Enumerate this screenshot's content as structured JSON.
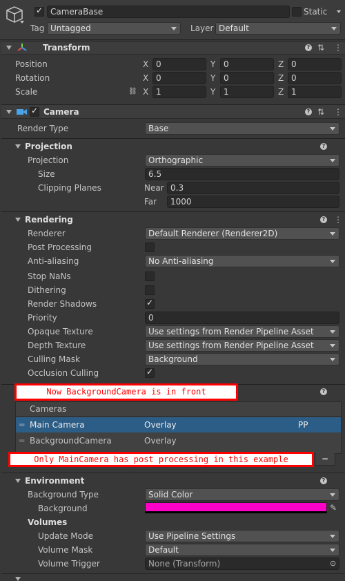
{
  "header": {
    "object_name": "CameraBase",
    "static_label": "Static",
    "tag_label": "Tag",
    "tag_value": "Untagged",
    "layer_label": "Layer",
    "layer_value": "Default"
  },
  "transform": {
    "title": "Transform",
    "position": {
      "label": "Position",
      "x": "0",
      "y": "0",
      "z": "0"
    },
    "rotation": {
      "label": "Rotation",
      "x": "0",
      "y": "0",
      "z": "0"
    },
    "scale": {
      "label": "Scale",
      "x": "1",
      "y": "1",
      "z": "1"
    },
    "axis_x": "X",
    "axis_y": "Y",
    "axis_z": "Z"
  },
  "camera": {
    "title": "Camera",
    "render_type_label": "Render Type",
    "render_type_value": "Base",
    "projection": {
      "title": "Projection",
      "projection_label": "Projection",
      "projection_value": "Orthographic",
      "size_label": "Size",
      "size_value": "6.5",
      "clipping_label": "Clipping Planes",
      "near_label": "Near",
      "near_value": "0.3",
      "far_label": "Far",
      "far_value": "1000"
    },
    "rendering": {
      "title": "Rendering",
      "renderer_label": "Renderer",
      "renderer_value": "Default Renderer (Renderer2D)",
      "post_processing_label": "Post Processing",
      "anti_aliasing_label": "Anti-aliasing",
      "anti_aliasing_value": "No Anti-aliasing",
      "stop_nans_label": "Stop NaNs",
      "dithering_label": "Dithering",
      "render_shadows_label": "Render Shadows",
      "priority_label": "Priority",
      "priority_value": "0",
      "opaque_texture_label": "Opaque Texture",
      "opaque_texture_value": "Use settings from Render Pipeline Asset",
      "depth_texture_label": "Depth Texture",
      "depth_texture_value": "Use settings from Render Pipeline Asset",
      "culling_mask_label": "Culling Mask",
      "culling_mask_value": "Background",
      "occlusion_culling_label": "Occlusion Culling"
    },
    "stack": {
      "header": "Cameras",
      "rows": [
        {
          "name": "Main Camera",
          "type": "Overlay",
          "pp": "PP"
        },
        {
          "name": "BackgroundCamera",
          "type": "Overlay",
          "pp": ""
        }
      ],
      "remove_label": "−"
    },
    "environment": {
      "title": "Environment",
      "background_type_label": "Background Type",
      "background_type_value": "Solid Color",
      "background_label": "Background",
      "background_color": "#ff00c8",
      "volumes_label": "Volumes",
      "update_mode_label": "Update Mode",
      "update_mode_value": "Use Pipeline Settings",
      "volume_mask_label": "Volume Mask",
      "volume_mask_value": "Default",
      "volume_trigger_label": "Volume Trigger",
      "volume_trigger_value": "None (Transform)"
    }
  },
  "annotations": {
    "note1": "Now BackgroundCamera is in front",
    "note2": "Only MainCamera has post processing in this example"
  },
  "colors": {
    "accent_row": "#2c5d87",
    "annotation_border": "#ff0000"
  }
}
